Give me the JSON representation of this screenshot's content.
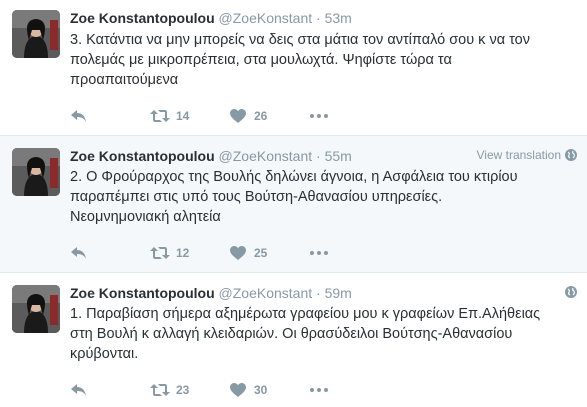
{
  "tweets": [
    {
      "name": "Zoe Konstantopoulou",
      "handle": "@ZoeKonstant",
      "separator": "·",
      "time": "53m",
      "lines": [
        "3. Κατάντια να μην μπορείς να δεις στα μάτια τον αντίπαλό σου κ να τον",
        "πολεμάς με μικροπρέπεια, στα μουλωχτά. Ψηφίστε τώρα τα",
        "προαπαιτούμενα"
      ],
      "retweets": "14",
      "likes": "26"
    },
    {
      "name": "Zoe Konstantopoulou",
      "handle": "@ZoeKonstant",
      "separator": "·",
      "time": "55m",
      "view_translation": "View translation",
      "lines": [
        "2. Ο Φρούραρχος της Βουλής δηλώνει άγνοια, η Ασφάλεια του κτιρίου",
        "παραπέμπει στις υπό τους Βούτση-Αθανασίου υπηρεσίες.",
        "Νεομνημονιακή αλητεία"
      ],
      "retweets": "12",
      "likes": "25"
    },
    {
      "name": "Zoe Konstantopoulou",
      "handle": "@ZoeKonstant",
      "separator": "·",
      "time": "59m",
      "lines": [
        "1. Παραβίαση σήμερα αξημέρωτα γραφείου μου κ γραφείων Επ.Αλήθειας",
        "στη Βουλή κ αλλαγή κλειδαριών. Οι θρασύδειλοι Βούτσης-Αθανασίου",
        "κρύβονται."
      ],
      "retweets": "23",
      "likes": "30"
    }
  ],
  "colors": {
    "text": "#292f33",
    "muted": "#8899a6",
    "highlight_bg": "#f5f8fa",
    "border": "#e1e8ed"
  }
}
